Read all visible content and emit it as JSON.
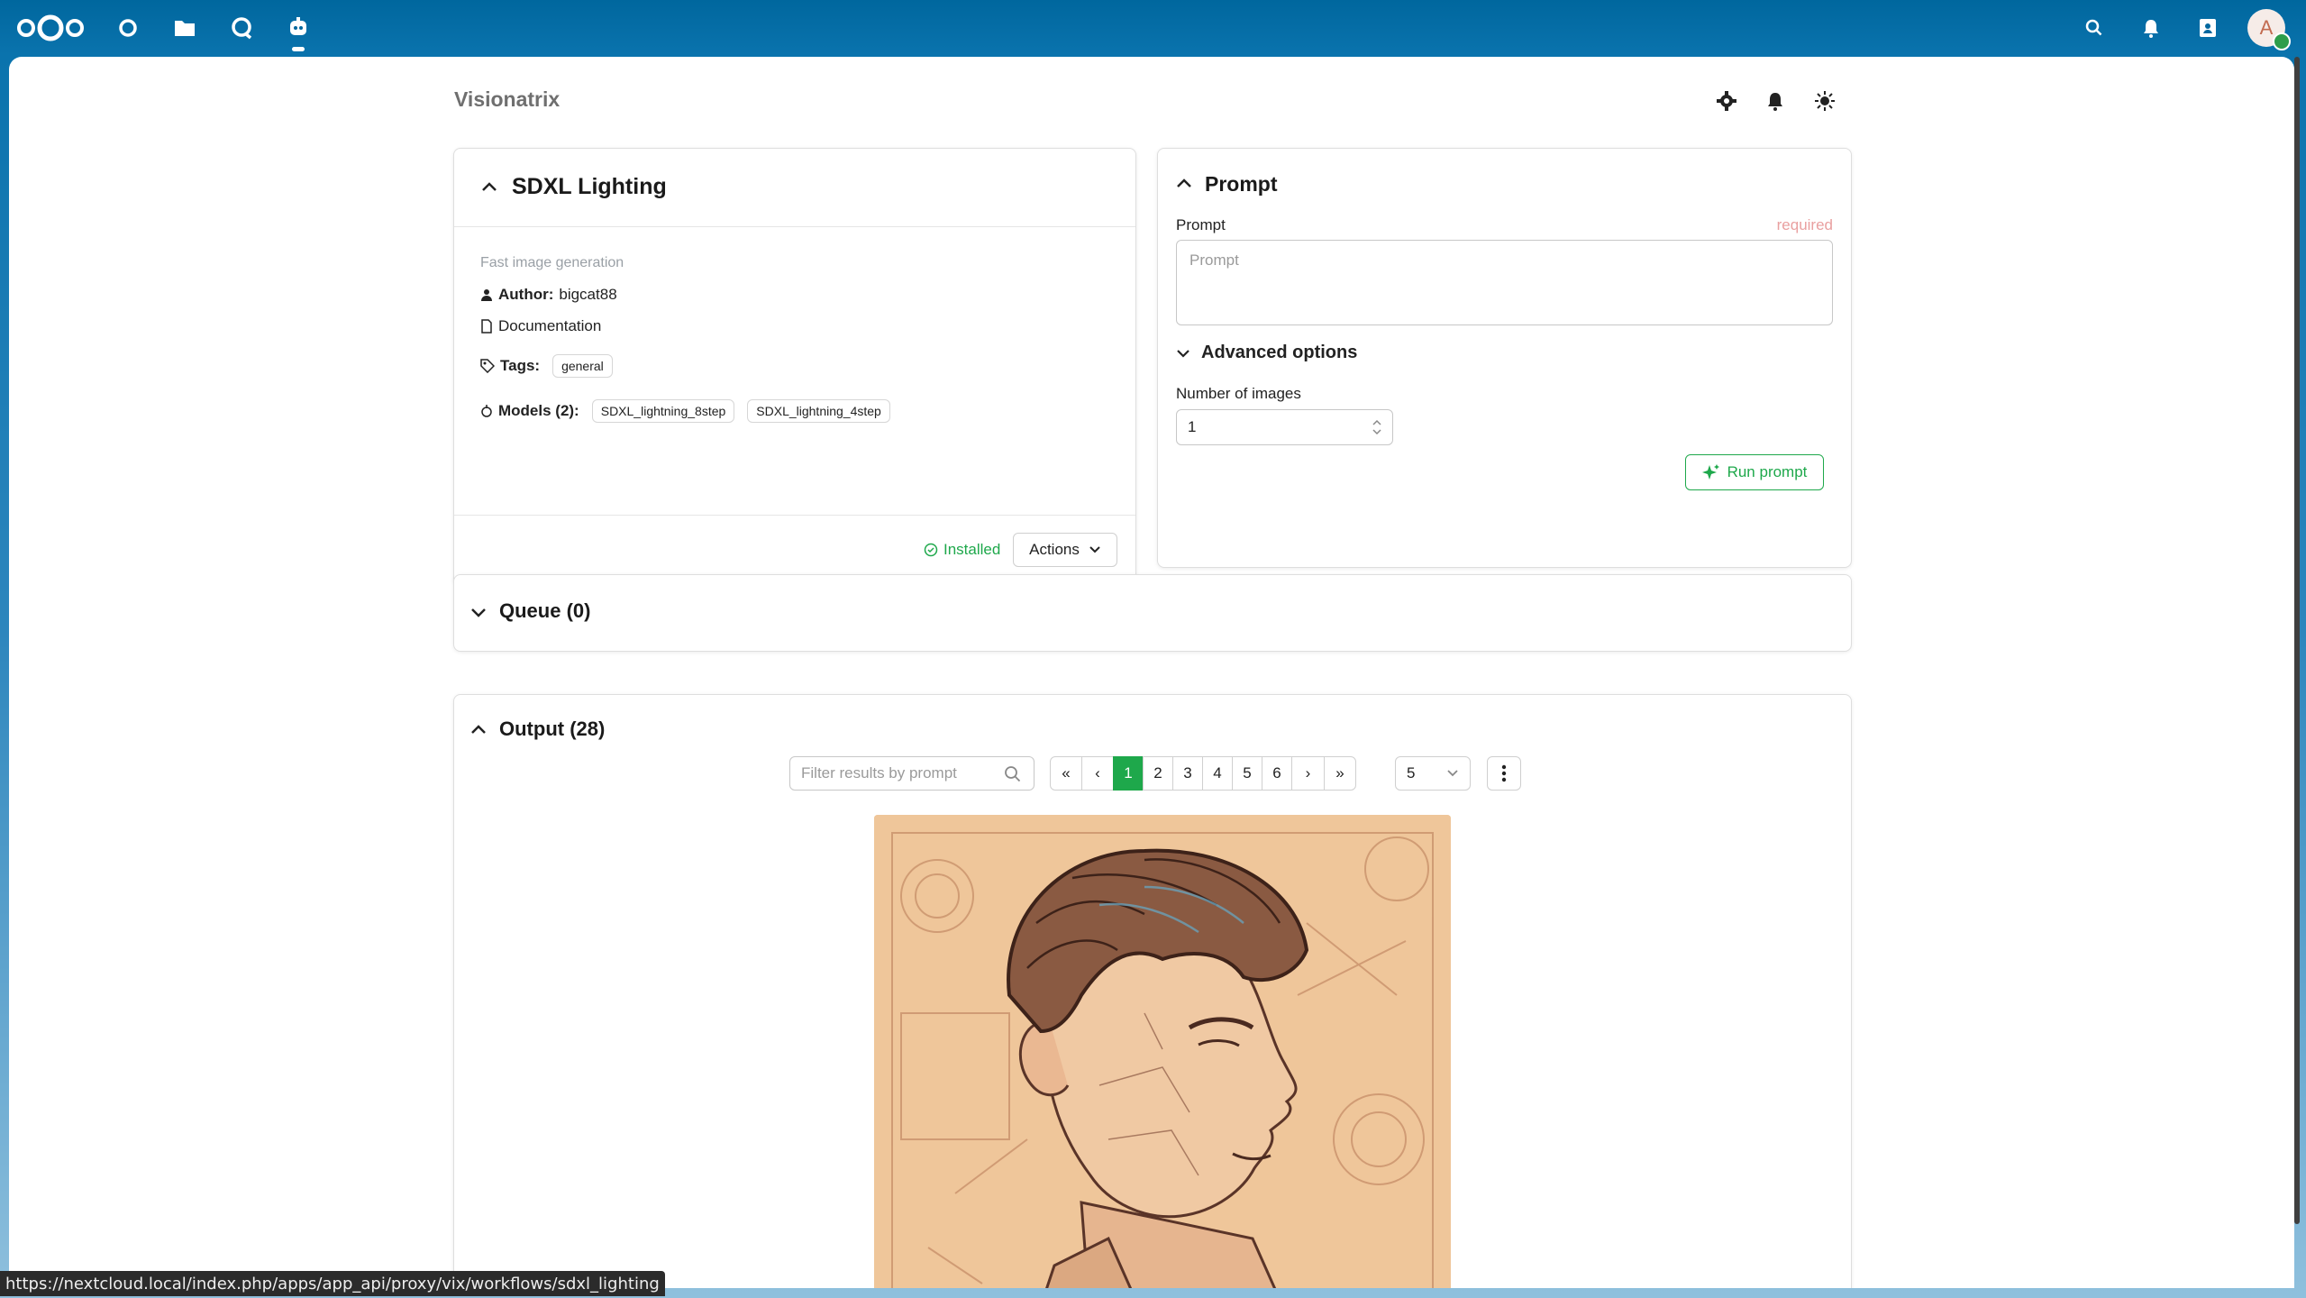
{
  "topbar": {
    "apps": [
      "dashboard-icon",
      "files-icon",
      "talk-icon",
      "visionatrix-icon"
    ],
    "right": [
      "search-icon",
      "notifications-icon",
      "contacts-icon"
    ],
    "avatar_letter": "A"
  },
  "header": {
    "title": "Visionatrix",
    "icons": [
      "settings-icon",
      "bell-icon",
      "theme-icon"
    ]
  },
  "workflow": {
    "title": "SDXL Lighting",
    "description": "Fast image generation",
    "author_label": "Author:",
    "author": "bigcat88",
    "documentation": "Documentation",
    "tags_label": "Tags:",
    "tags": [
      "general"
    ],
    "models_label": "Models (2):",
    "models": [
      "SDXL_lightning_8step",
      "SDXL_lightning_4step"
    ],
    "status": "Installed",
    "actions": "Actions"
  },
  "prompt_card": {
    "title": "Prompt",
    "field_label": "Prompt",
    "required": "required",
    "placeholder": "Prompt",
    "advanced": "Advanced options",
    "num_images_label": "Number of images",
    "num_images": "1",
    "run": "Run prompt"
  },
  "queue": {
    "title": "Queue (0)"
  },
  "output": {
    "title": "Output (28)",
    "filter_placeholder": "Filter results by prompt",
    "pages": [
      "1",
      "2",
      "3",
      "4",
      "5",
      "6"
    ],
    "current_page": "1",
    "page_size": "5",
    "nav": {
      "first": "«",
      "prev": "‹",
      "next": "›",
      "last": "»"
    }
  },
  "status_bar": {
    "url": "https://nextcloud.local/index.php/apps/app_api/proxy/vix/workflows/sdxl_lighting"
  },
  "colors": {
    "brand": "#00679e",
    "accent": "#1ea84b",
    "required": "#e9a0a0"
  }
}
